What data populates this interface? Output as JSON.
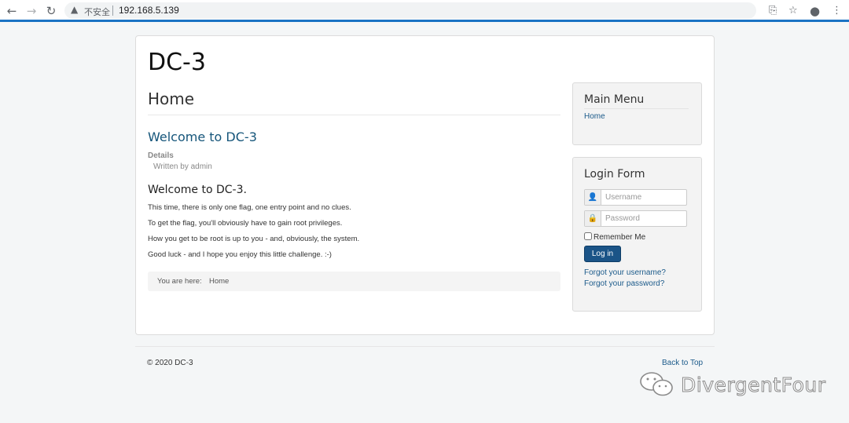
{
  "browser": {
    "insecure_label": "不安全",
    "url": "192.168.5.139"
  },
  "site": {
    "brand": "DC-3",
    "page_heading": "Home"
  },
  "article": {
    "title": "Welcome to DC-3",
    "details_label": "Details",
    "written_by": "Written by admin",
    "heading": "Welcome to DC-3.",
    "paragraphs": [
      "This time, there is only one flag, one entry point and no clues.",
      "To get the flag, you'll obviously have to gain root privileges.",
      "How you get to be root is up to you - and, obviously, the system.",
      "Good luck - and I hope you enjoy this little challenge.  :-)"
    ]
  },
  "breadcrumb": {
    "label": "You are here:",
    "current": "Home"
  },
  "main_menu": {
    "title": "Main Menu",
    "items": [
      {
        "label": "Home"
      }
    ]
  },
  "login_form": {
    "title": "Login Form",
    "username_placeholder": "Username",
    "password_placeholder": "Password",
    "remember_label": "Remember Me",
    "submit_label": "Log in",
    "forgot_username": "Forgot your username?",
    "forgot_password": "Forgot your password?"
  },
  "footer": {
    "copyright": "© 2020 DC-3",
    "back_to_top": "Back to Top"
  },
  "watermark": {
    "text": "DivergentFour"
  },
  "colors": {
    "link": "#1b5a8a",
    "button": "#1b5487",
    "accent_bar": "#1a73c4"
  }
}
